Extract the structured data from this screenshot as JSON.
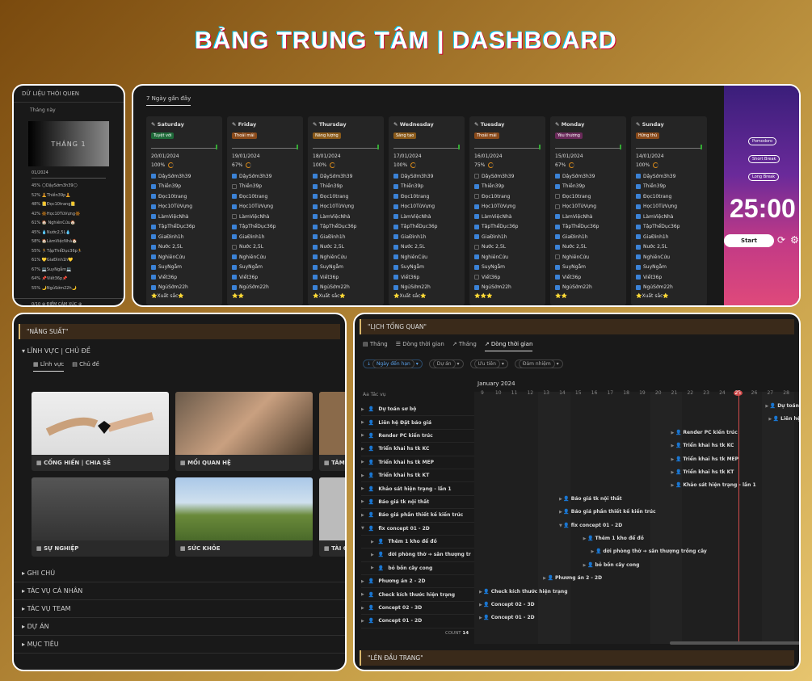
{
  "title": "BẢNG TRUNG TÂM | DASHBOARD",
  "habits_panel": {
    "header": "DỮ LIỆU THÓI QUEN",
    "filter": "Tháng này",
    "thumb_label": "THÁNG 1",
    "month": "01/2024",
    "rows": [
      "45% 🌕DậySớm3h39🌕",
      "52% 🧘Thiền39p🧘",
      "48% 📒Đọc10trang📒",
      "42% 🔆Học10TừVựng🔆",
      "61% 🏠 NghiênCứu🏠",
      "45% 💧Nước2,5L💧",
      "58% 🏠LàmViệcNhà🏠",
      "55% 🏃TậpThểDục36p🏃",
      "61% 💛GiaĐình1h💛",
      "67% 💻SuyNgẫm💻",
      "64% 📌Viết36p📌",
      "55% 🌙NgủSớm22h🌙"
    ],
    "footer": "0/10 ⊕ ĐIỂM CẢM XÚC ⊕"
  },
  "week_panel": {
    "tab": "7 Ngày gần đây",
    "habits": [
      "DậySớm3h39",
      "Thiền39p",
      "Đọc10trang",
      "Học10TừVựng",
      "LàmViệcNhà",
      "TậpThểDục36p",
      "GiaĐình1h",
      "Nước 2,5L",
      "NghiênCứu",
      "SuyNgẫm",
      "Viết36p",
      "NgủSớm22h"
    ],
    "days": [
      {
        "name": "Saturday",
        "mood": "Tuyệt vời",
        "mood_color": "#1f6b3a",
        "date": "20/01/2024",
        "pct": "100%",
        "checks": [
          1,
          1,
          1,
          1,
          1,
          1,
          1,
          1,
          1,
          1,
          1,
          1
        ],
        "rating": "⭐Xuất sắc⭐"
      },
      {
        "name": "Friday",
        "mood": "Thoải mái",
        "mood_color": "#8a4a1a",
        "date": "19/01/2024",
        "pct": "67%",
        "checks": [
          1,
          0,
          1,
          1,
          0,
          1,
          1,
          0,
          1,
          1,
          1,
          1
        ],
        "rating": "⭐⭐"
      },
      {
        "name": "Thursday",
        "mood": "Năng lượng",
        "mood_color": "#8a5a1a",
        "date": "18/01/2024",
        "pct": "100%",
        "checks": [
          1,
          1,
          1,
          1,
          1,
          1,
          1,
          1,
          1,
          1,
          1,
          1
        ],
        "rating": "⭐Xuất sắc⭐"
      },
      {
        "name": "Wednesday",
        "mood": "Sáng tạo",
        "mood_color": "#8a5a1a",
        "date": "17/01/2024",
        "pct": "100%",
        "checks": [
          1,
          1,
          1,
          1,
          1,
          1,
          1,
          1,
          1,
          1,
          1,
          1
        ],
        "rating": "⭐Xuất sắc⭐"
      },
      {
        "name": "Tuesday",
        "mood": "Thoải mái",
        "mood_color": "#8a4a1a",
        "date": "16/01/2024",
        "pct": "75%",
        "checks": [
          0,
          1,
          0,
          1,
          1,
          1,
          1,
          0,
          1,
          1,
          0,
          1
        ],
        "rating": "⭐⭐⭐"
      },
      {
        "name": "Monday",
        "mood": "Yêu thương",
        "mood_color": "#6a2a5a",
        "date": "15/01/2024",
        "pct": "67%",
        "checks": [
          1,
          1,
          0,
          0,
          1,
          1,
          1,
          1,
          0,
          1,
          1,
          1
        ],
        "rating": "⭐⭐"
      },
      {
        "name": "Sunday",
        "mood": "Hứng thú",
        "mood_color": "#8a4a1a",
        "date": "14/01/2024",
        "pct": "100%",
        "checks": [
          1,
          1,
          1,
          1,
          1,
          1,
          1,
          1,
          1,
          1,
          1,
          1
        ],
        "rating": "⭐Xuất sắc⭐"
      }
    ]
  },
  "pomodoro": {
    "btn1": "Pomodoro",
    "btn2": "Short Break",
    "btn3": "Long Break",
    "time": "25:00",
    "start": "Start"
  },
  "productivity": {
    "header": "\"NĂNG SUẤT\"",
    "area_toggle": "LĨNH VỰC | CHỦ ĐỀ",
    "tab1": "Lĩnh vực",
    "tab2": "Chủ đề",
    "cards": [
      "CỐNG HIẾN | CHIA SẺ",
      "MỐI QUAN HỆ",
      "TÂM",
      "SỰ NGHIỆP",
      "SỨC KHỎE",
      "TÀI C"
    ],
    "toggles": [
      "GHI CHÚ",
      "TÁC VỤ CÁ NHÂN",
      "TÁC VỤ TEAM",
      "DỰ ÁN",
      "MỤC TIÊU"
    ]
  },
  "calendar": {
    "header": "\"LỊCH TỔNG QUAN\"",
    "tabs": [
      "Tháng",
      "Dòng thời gian",
      "Tháng",
      "Dòng thời gian"
    ],
    "filters": [
      "Ngày đến hạn",
      "Dự án",
      "Ưu tiên",
      "Đảm nhiệm"
    ],
    "month": "January 2024",
    "col_header": "Tác vụ",
    "days": [
      "9",
      "10",
      "11",
      "12",
      "13",
      "14",
      "15",
      "16",
      "17",
      "18",
      "19",
      "20",
      "21",
      "22",
      "23",
      "24",
      "25",
      "26",
      "27",
      "28"
    ],
    "today": "25",
    "tasks": [
      "Dự toán sơ bộ",
      "Liên hệ Đặt báo giá",
      "Render PC kiến trúc",
      "Triển khai hs tk KC",
      "Triển khai hs tk MEP",
      "Triển khai hs tk KT",
      "Khảo sát hiện trạng - lần 1",
      "Báo giá tk nội thất",
      "Báo giá phần thiết kế kiến trúc",
      "fix concept 01 - 2D",
      "Thêm 1 kho để đồ",
      "dời phòng thờ ➔ sân thượng tr",
      "bỏ bồn cây cong",
      "Phương án 2 - 2D",
      "Check kích thước hiện trạng",
      "Concept 02 - 3D",
      "Concept 01 - 2D"
    ],
    "bars": [
      "Dự toán sơ bộ",
      "Liên hệ",
      "Render PC kiến trúc",
      "Triển khai hs tk KC",
      "Triển khai hs tk MEP",
      "Triển khai hs tk KT",
      "Khảo sát hiện trạng - lần 1",
      "Báo giá tk nội thất",
      "Báo giá phần thiết kế kiến trúc",
      "fix concept 01 - 2D",
      "Thêm 1 kho để đồ",
      "dời phòng thờ ➔ sân thượng trồng cây",
      "bỏ bồn cây cong",
      "Phương án 2 - 2D",
      "Check kích thước hiện trạng",
      "Concept 02 - 3D",
      "Concept 01 - 2D"
    ],
    "count_label": "COUNT",
    "count": "14",
    "footer_head": "\"LÊN ĐẦU TRANG\""
  }
}
